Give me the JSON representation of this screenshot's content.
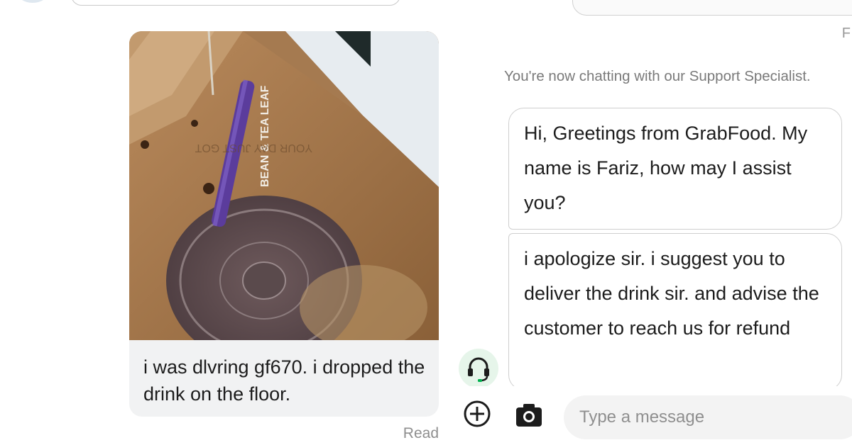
{
  "left_panel": {
    "photo": {
      "straw_print": "BEAN & TEA LEAF",
      "bag_print": "YOUR DAY JUST GOT"
    },
    "caption": "i was dlvring gf670. i dropped the drink on the floor.",
    "status": "Read"
  },
  "right_panel": {
    "corner_fragment": "F",
    "system_notice": "You're now chatting with our Support Specialist.",
    "messages": [
      {
        "text": "Hi, Greetings from GrabFood. My name is Fariz, how may I assist you?"
      },
      {
        "text": "i apologize sir. i suggest you to deliver the drink sir. and advise the customer to reach us for refund"
      }
    ],
    "agent_avatar_icon": "headset-icon",
    "composer": {
      "add_icon": "plus-circle-icon",
      "camera_icon": "camera-icon",
      "placeholder": "Type a message"
    }
  },
  "colors": {
    "agent_green": "#00b14f",
    "bubble_border": "#cfcfcf",
    "photo_bubble_bg": "#f1f2f3",
    "muted_text": "#8e8e8e"
  }
}
